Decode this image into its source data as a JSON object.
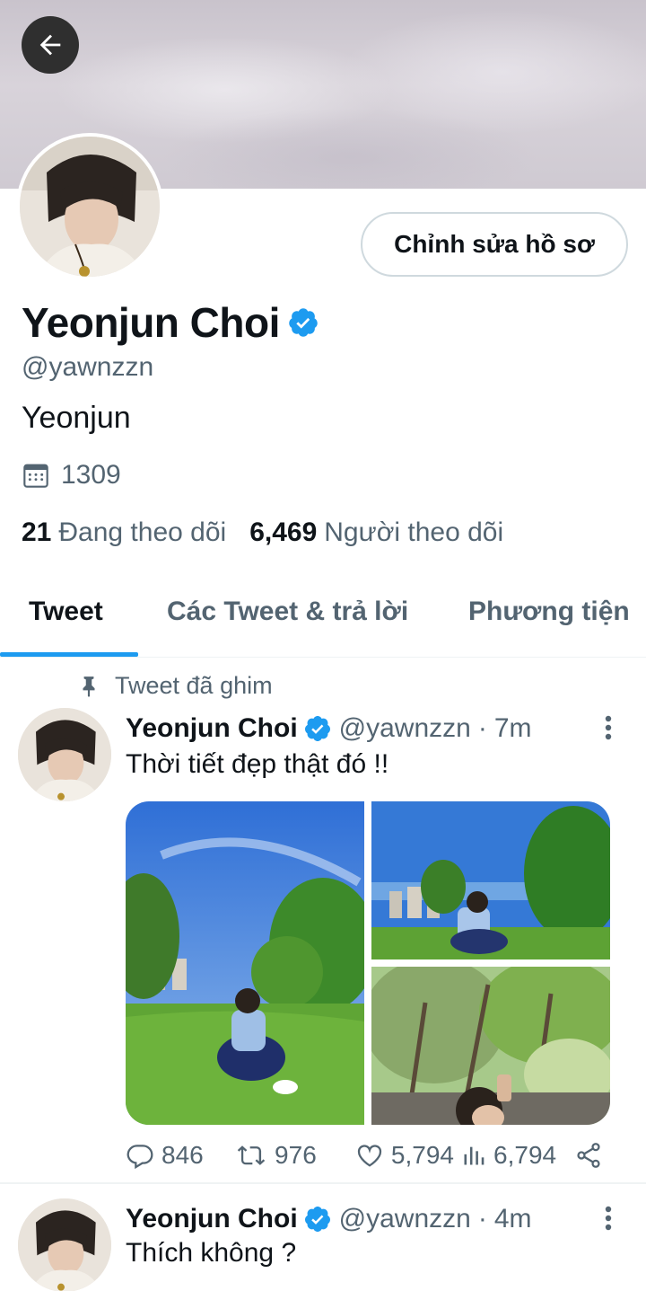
{
  "profile": {
    "display_name": "Yeonjun Choi",
    "handle": "@yawnzzn",
    "bio": "Yeonjun",
    "meta_value": "1309",
    "edit_button": "Chỉnh sửa hồ sơ",
    "following_count": "21",
    "following_label": "Đang theo dõi",
    "followers_count": "6,469",
    "followers_label": "Người theo dõi"
  },
  "tabs": [
    {
      "label": "Tweet",
      "active": true
    },
    {
      "label": "Các Tweet & trả lời",
      "active": false
    },
    {
      "label": "Phương tiện",
      "active": false
    }
  ],
  "pinned_label": "Tweet đã ghim",
  "tweets": [
    {
      "name": "Yeonjun Choi",
      "handle": "@yawnzzn",
      "separator": "·",
      "time": "7m",
      "text": "Thời tiết đẹp thật đó !!",
      "replies": "846",
      "retweets": "976",
      "likes": "5,794",
      "views": "6,794"
    },
    {
      "name": "Yeonjun Choi",
      "handle": "@yawnzzn",
      "separator": "·",
      "time": "4m",
      "text": "Thích không ?"
    }
  ],
  "colors": {
    "accent": "#1d9bf0",
    "text": "#0f1419",
    "muted": "#536471",
    "back_button": "#2f2f2f"
  },
  "icons": {
    "back": "arrow-left-icon",
    "verified": "verified-badge-icon",
    "calendar": "calendar-icon",
    "pin": "pin-icon",
    "more": "more-vertical-icon",
    "reply": "reply-icon",
    "retweet": "retweet-icon",
    "like": "heart-icon",
    "views": "views-icon",
    "share": "share-icon"
  }
}
